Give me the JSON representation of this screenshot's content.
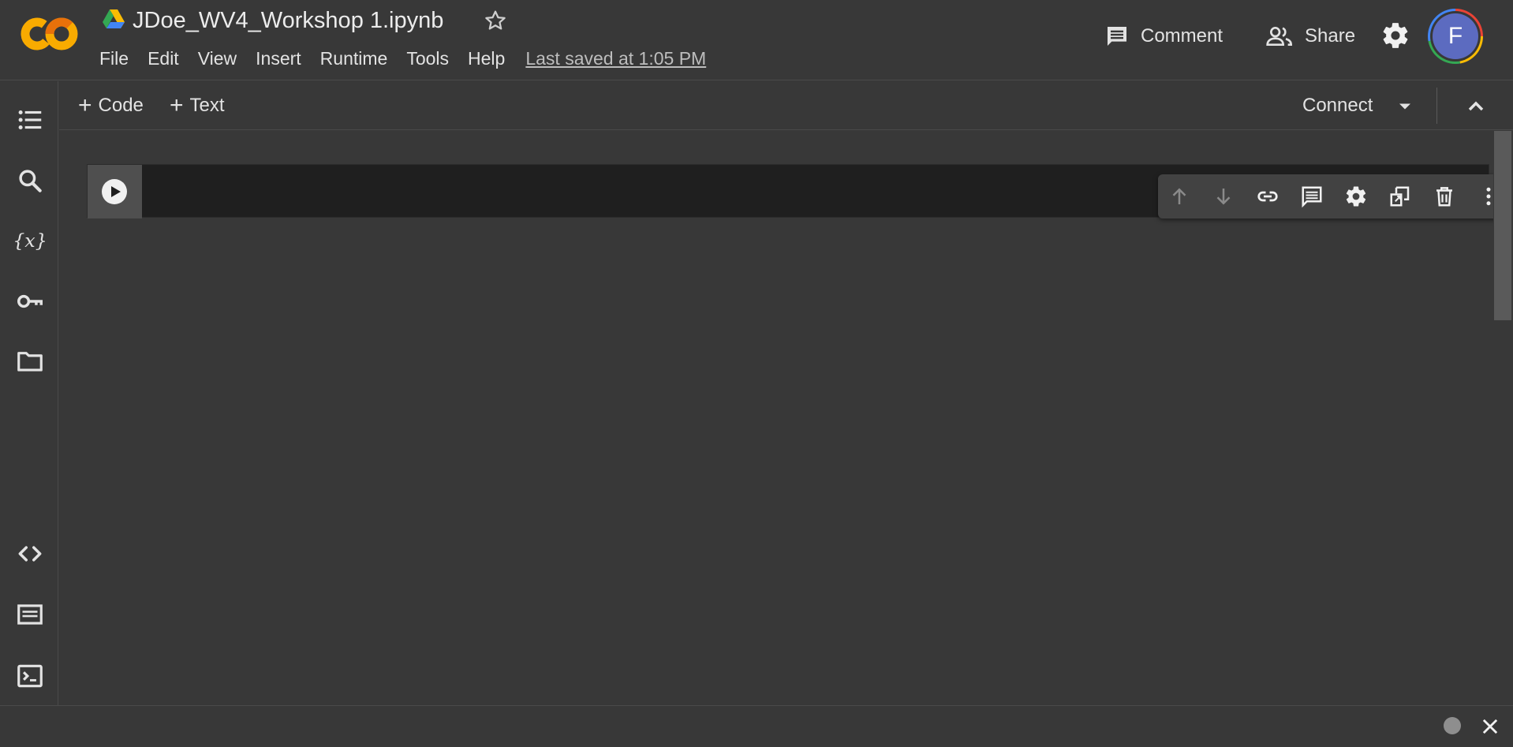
{
  "header": {
    "logo_text": "CO",
    "title": "JDoe_WV4_Workshop 1.ipynb",
    "menu": [
      "File",
      "Edit",
      "View",
      "Insert",
      "Runtime",
      "Tools",
      "Help"
    ],
    "last_saved": "Last saved at 1:05 PM",
    "comment_label": "Comment",
    "share_label": "Share",
    "avatar_initial": "F"
  },
  "sidebar": {
    "icons": [
      "table-of-contents-icon",
      "search-icon",
      "variables-icon",
      "secrets-key-icon",
      "files-folder-icon",
      "code-snippets-icon",
      "command-palette-icon",
      "terminal-icon"
    ]
  },
  "toolbar": {
    "add_code_label": "Code",
    "add_text_label": "Text",
    "plus_symbol": "+",
    "connect_label": "Connect"
  },
  "cell_toolbar": {
    "icons": [
      "move-up-icon",
      "move-down-icon",
      "link-icon",
      "comment-icon",
      "settings-icon",
      "mirror-cell-icon",
      "delete-icon",
      "more-vert-icon"
    ]
  },
  "colors": {
    "background": "#383838",
    "cell_background": "#1f1f1f",
    "logo_orange": "#f9ab00",
    "avatar": "#5c6bc0"
  }
}
